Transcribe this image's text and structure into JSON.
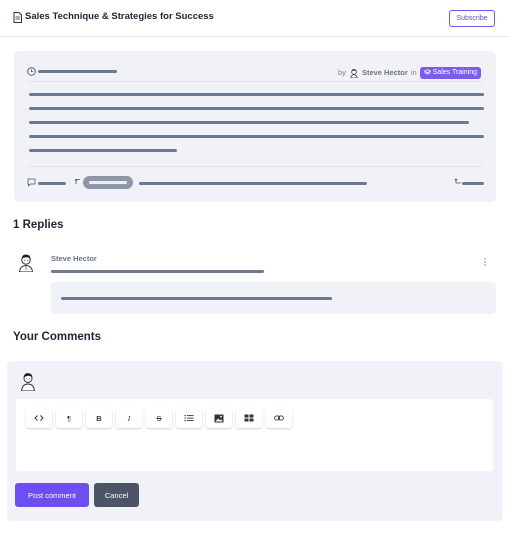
{
  "header": {
    "title": "Sales Technique & Strategies for Success",
    "subscribe_label": "Subscribe",
    "doc_icon": "document-icon"
  },
  "post": {
    "meta_by": "by",
    "author": "Steve Hector",
    "meta_in": "in",
    "category": "Sales Training",
    "icons": [
      "clock-icon",
      "comment-icon",
      "retweet-icon",
      "reply-icon",
      "layers-icon"
    ]
  },
  "replies": {
    "title": "1 Replies",
    "items": [
      {
        "author": "Steve Hector"
      }
    ]
  },
  "comments": {
    "title": "Your Comments",
    "toolbar": [
      {
        "name": "code-button",
        "icon": "code-icon",
        "glyph": "<>"
      },
      {
        "name": "paragraph-button",
        "icon": "pilcrow-icon",
        "glyph": "¶"
      },
      {
        "name": "bold-button",
        "icon": "bold-icon",
        "glyph": "B"
      },
      {
        "name": "italic-button",
        "icon": "italic-icon",
        "glyph": "I"
      },
      {
        "name": "strikethrough-button",
        "icon": "strikethrough-icon",
        "glyph": "S"
      },
      {
        "name": "list-button",
        "icon": "list-icon",
        "glyph": ""
      },
      {
        "name": "image-button",
        "icon": "image-icon",
        "glyph": ""
      },
      {
        "name": "table-button",
        "icon": "table-icon",
        "glyph": ""
      },
      {
        "name": "link-button",
        "icon": "link-icon",
        "glyph": ""
      }
    ],
    "post_label": "Post comment",
    "cancel_label": "Cancel"
  },
  "colors": {
    "accent": "#6d4ef0",
    "badge": "#7c5cf0",
    "skeleton": "#6b7a8f",
    "card_bg": "#f0f2f7",
    "cancel_bg": "#4b5563"
  }
}
